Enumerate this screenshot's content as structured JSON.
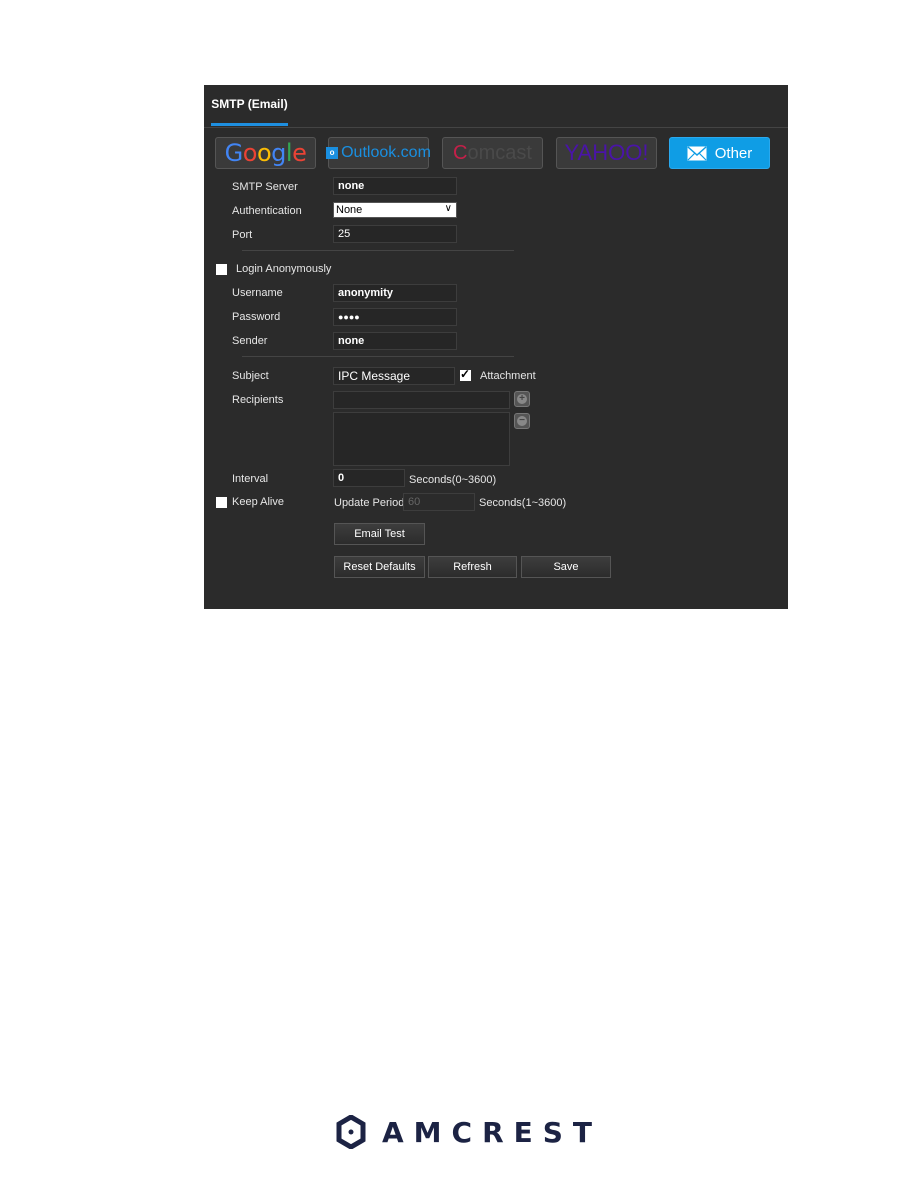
{
  "tab": {
    "label": "SMTP (Email)"
  },
  "providers": [
    {
      "name": "Google",
      "active": false
    },
    {
      "name": "Outlook.com",
      "active": false
    },
    {
      "name": "comcast",
      "active": false
    },
    {
      "name": "YAHOO!",
      "active": false
    },
    {
      "name": "Other",
      "active": true
    }
  ],
  "colors": {
    "accent": "#1e8fe0",
    "active_provider": "#0f9de5",
    "panel_bg": "#2b2b2b"
  },
  "form": {
    "smtp_server": {
      "label": "SMTP Server",
      "value": "none"
    },
    "authentication": {
      "label": "Authentication",
      "value": "None"
    },
    "port": {
      "label": "Port",
      "value": "25"
    },
    "login_anonymously": {
      "label": "Login Anonymously",
      "checked": false
    },
    "username": {
      "label": "Username",
      "value": "anonymity"
    },
    "password": {
      "label": "Password",
      "value": "●●●●"
    },
    "sender": {
      "label": "Sender",
      "value": "none"
    },
    "subject": {
      "label": "Subject",
      "value": "IPC Message"
    },
    "attachment": {
      "label": "Attachment",
      "checked": true
    },
    "recipients": {
      "label": "Recipients",
      "value": ""
    },
    "interval": {
      "label": "Interval",
      "value": "0",
      "unit": "Seconds(0~3600)"
    },
    "keep_alive": {
      "label": "Keep Alive",
      "checked": false
    },
    "update_period": {
      "label": "Update Period",
      "value": "60",
      "unit": "Seconds(1~3600)"
    }
  },
  "buttons": {
    "email_test": "Email Test",
    "reset_defaults": "Reset Defaults",
    "refresh": "Refresh",
    "save": "Save"
  },
  "footer": {
    "brand": "AMCREST"
  }
}
